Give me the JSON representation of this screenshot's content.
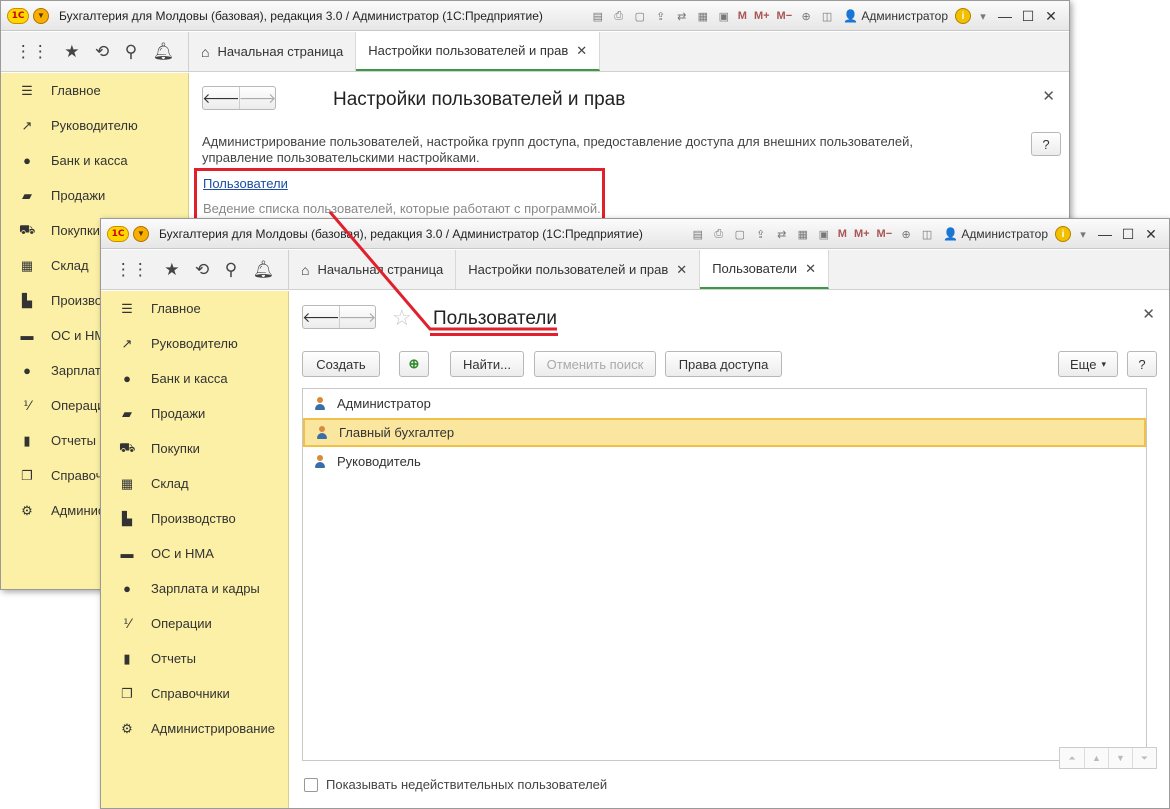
{
  "app_title": "Бухгалтерия для Молдовы (базовая), редакция 3.0 / Администратор  (1С:Предприятие)",
  "user_name": "Администратор",
  "toolbar_m_labels": [
    "M",
    "M+",
    "M−"
  ],
  "sidebar": {
    "items": [
      {
        "label": "Главное",
        "icon": "menu-lines-icon"
      },
      {
        "label": "Руководителю",
        "icon": "trend-icon"
      },
      {
        "label": "Банк и касса",
        "icon": "ruble-coin-icon"
      },
      {
        "label": "Продажи",
        "icon": "shopping-bag-icon"
      },
      {
        "label": "Покупки",
        "icon": "cart-icon"
      },
      {
        "label": "Склад",
        "icon": "warehouse-grid-icon"
      },
      {
        "label": "Производство",
        "icon": "factory-icon"
      },
      {
        "label": "ОС и НМА",
        "icon": "truck-icon"
      },
      {
        "label": "Зарплата и кадры",
        "icon": "person-icon"
      },
      {
        "label": "Операции",
        "icon": "debit-credit-icon"
      },
      {
        "label": "Отчеты",
        "icon": "bar-chart-icon"
      },
      {
        "label": "Справочники",
        "icon": "books-icon"
      },
      {
        "label": "Администрирование",
        "icon": "gear-icon"
      }
    ]
  },
  "back_window": {
    "tabs": [
      {
        "label": "Начальная страница"
      },
      {
        "label": "Настройки пользователей и прав"
      }
    ],
    "form_title": "Настройки пользователей и прав",
    "description": "Администрирование пользователей, настройка групп доступа, предоставление доступа для внешних пользователей, управление пользовательскими настройками.",
    "users_link": "Пользователи",
    "users_link_desc": "Ведение списка пользователей, которые работают с программой."
  },
  "front_window": {
    "tabs": [
      {
        "label": "Начальная страница"
      },
      {
        "label": "Настройки пользователей и прав"
      },
      {
        "label": "Пользователи"
      }
    ],
    "form_title": "Пользователи",
    "buttons": {
      "create": "Создать",
      "find": "Найти...",
      "cancel_search": "Отменить поиск",
      "access_rights": "Права доступа",
      "more": "Еще",
      "help": "?"
    },
    "users": [
      {
        "name": "Администратор",
        "selected": false
      },
      {
        "name": "Главный бухгалтер",
        "selected": true
      },
      {
        "name": "Руководитель",
        "selected": false
      }
    ],
    "show_inactive_label": "Показывать недействительных пользователей",
    "show_inactive_checked": false
  },
  "colors": {
    "sidebar_bg": "#fbf0a6",
    "selection_bg": "#fbe6a0",
    "annotation_red": "#e0202c",
    "active_tab_underline": "#3c9a44",
    "link": "#1c4fa0"
  }
}
